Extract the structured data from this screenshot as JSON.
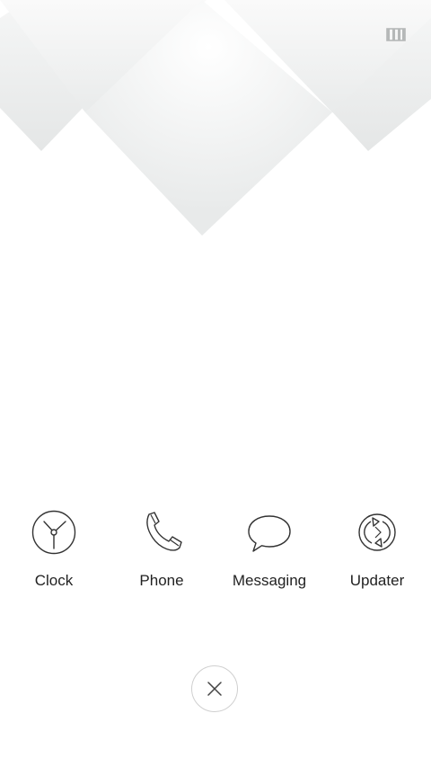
{
  "header": {
    "recents_icon": "multi-window-icon"
  },
  "apps": [
    {
      "label": "Clock",
      "icon": "clock-icon"
    },
    {
      "label": "Phone",
      "icon": "phone-icon"
    },
    {
      "label": "Messaging",
      "icon": "messaging-icon"
    },
    {
      "label": "Updater",
      "icon": "updater-icon"
    }
  ],
  "footer": {
    "close_icon": "close-icon"
  },
  "colors": {
    "background": "#ffffff",
    "diamond_shade": "#e6e8e8",
    "icon_stroke": "#333333",
    "label_text": "#222222"
  }
}
